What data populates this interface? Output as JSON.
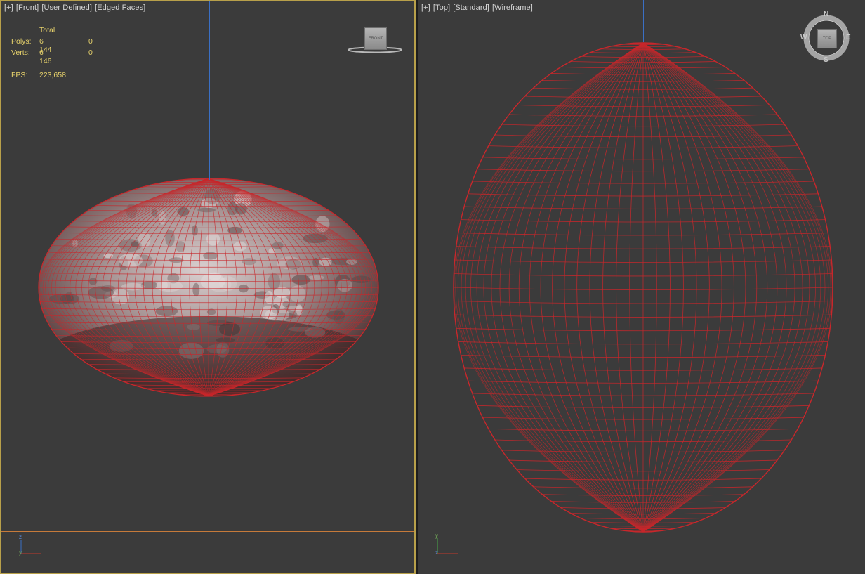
{
  "left_viewport": {
    "label_parts": [
      "[+]",
      "[Front]",
      "[User Defined]",
      "[Edged Faces]"
    ],
    "stats": {
      "total_header": "Total",
      "rows": [
        {
          "label": "Polys:",
          "total": "6 144",
          "sel": "0"
        },
        {
          "label": "Verts:",
          "total": "6 146",
          "sel": "0"
        }
      ],
      "fps_label": "FPS:",
      "fps_value": "223,658"
    },
    "viewcube_label": "FRONT",
    "axis_labels": {
      "up": "z",
      "right": "y"
    }
  },
  "right_viewport": {
    "label_parts": [
      "[+]",
      "[Top]",
      "[Standard]",
      "[Wireframe]"
    ],
    "viewcube_label": "TOP",
    "compass": {
      "n": "N",
      "s": "S",
      "e": "E",
      "w": "W"
    },
    "axis_labels": {
      "up": "y",
      "right": "z"
    }
  },
  "colors": {
    "viewport_bg": "#3b3b3b",
    "active_border": "#b8a04a",
    "wireframe": "#c8272b",
    "grid_line_orange": "#c67a3a",
    "grid_line_blue": "#3a6fc4",
    "stats_text": "#e6d16b"
  },
  "icons": {
    "viewcube": "viewcube-icon",
    "compass": "compass-ring-icon",
    "axis_tripod": "axis-tripod-icon"
  }
}
